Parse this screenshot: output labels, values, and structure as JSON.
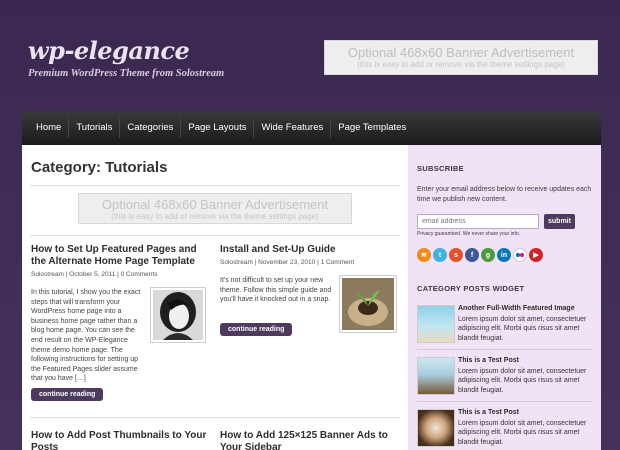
{
  "site": {
    "title": "wp-elegance",
    "tagline": "Premium WordPress Theme from Solostream"
  },
  "header_banner": {
    "line1": "Optional 468x60 Banner Advertisement",
    "line2": "(this is easy to add or remove via the theme settings page)"
  },
  "nav": {
    "items": [
      "Home",
      "Tutorials",
      "Categories",
      "Page Layouts",
      "Wide Features",
      "Page Templates"
    ]
  },
  "main": {
    "page_title": "Category: Tutorials",
    "banner": {
      "line1": "Optional 468x60 Banner Advertisement",
      "line2": "(this is easy to add or remove via the theme settings page)"
    },
    "posts": [
      {
        "title": "How to Set Up Featured Pages and the Alternate Home Page Template",
        "meta": "Solostream | October 5, 2011 | 0 Comments",
        "excerpt": "In this tutorial, I show you the exact steps that will transform your WordPress home page into a business home page rather than a blog home page. You can see the end result on the WP-Elegance theme demo home page.   The following instructions for setting up the Featured Pages slider assume that you have […]",
        "button": "continue reading"
      },
      {
        "title": "Install and Set-Up Guide",
        "meta": "Solostream | November 23, 2010 | 1 Comment",
        "excerpt": "It's not difficult to set up your new theme. Follow this simple guide and you'll have it knocked out in a snap.",
        "button": "continue reading"
      },
      {
        "title": "How to Add Post Thumbnails to Your Posts"
      },
      {
        "title": "How to Add 125×125 Banner Ads to Your Sidebar"
      }
    ]
  },
  "sidebar": {
    "subscribe": {
      "heading": "SUBSCRIBE",
      "text": "Enter your email address below to receive updates each time we publish new content.",
      "placeholder": "email address",
      "submit": "submit",
      "privacy": "Privacy guaranteed. We never share your info."
    },
    "social_icons": [
      "rss-icon",
      "twitter-icon",
      "stumbleupon-icon",
      "facebook-icon",
      "google-icon",
      "linkedin-icon",
      "flickr-icon",
      "youtube-icon"
    ],
    "category_widget": {
      "heading": "CATEGORY POSTS WIDGET",
      "items": [
        {
          "title": "Another Full-Width Featured Image",
          "excerpt": "Lorem ipsum dolor sit amet, consectetuer adipiscing elit. Morbi quis risus sit amet blandit feugiat."
        },
        {
          "title": "This is a Test Post",
          "excerpt": "Lorem ipsum dolor sit amet, consectetuer adipiscing elit. Morbi quis risus sit amet blandit feugiat."
        },
        {
          "title": "This is a Test Post",
          "excerpt": "Lorem ipsum dolor sit amet, consectetuer adipiscing elit. Morbi quis risus sit amet blandit feugiat."
        }
      ]
    }
  },
  "colors": {
    "background": "#3f2b55",
    "accent": "#4d3a5e",
    "sidebar_bg": "#f1e3f6",
    "nav_bg": "#1b1b1b"
  }
}
